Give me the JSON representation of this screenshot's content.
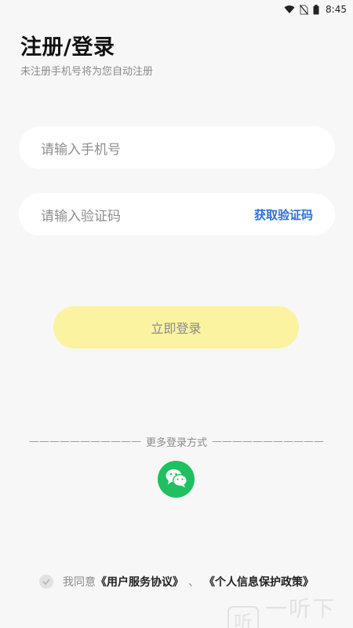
{
  "status_bar": {
    "time": "8:45",
    "icons": [
      "wifi-icon",
      "no-sim-icon",
      "battery-icon"
    ]
  },
  "header": {
    "title": "注册/登录",
    "subtitle": "未注册手机号将为您自动注册"
  },
  "form": {
    "phone_placeholder": "请输入手机号",
    "code_placeholder": "请输入验证码",
    "get_code_label": "获取验证码",
    "login_label": "立即登录"
  },
  "other_login": {
    "dashes_left": "———————————",
    "label": "更多登录方式",
    "dashes_right": "———————————",
    "wechat_icon": "wechat-icon"
  },
  "agreement": {
    "prefix": "我同意",
    "user_agreement": "《用户服务协议》",
    "separator": "、",
    "privacy_policy": "《个人信息保护政策》"
  },
  "watermark": {
    "text": "一听下载"
  },
  "colors": {
    "accent_link": "#2f6fd6",
    "login_button": "#fbf3a0",
    "wechat": "#20c060",
    "background": "#f7f7f7"
  }
}
